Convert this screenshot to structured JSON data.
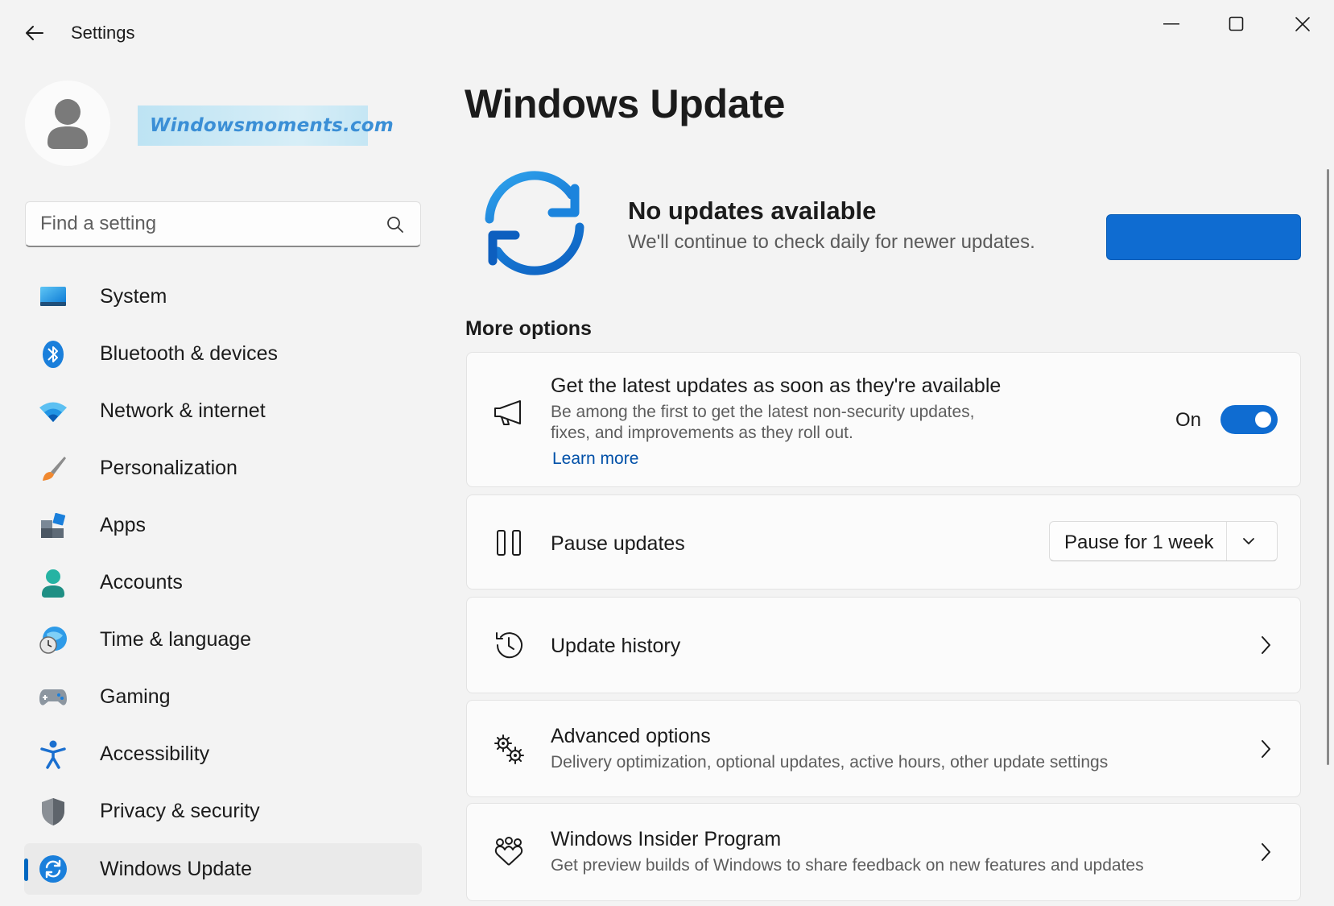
{
  "window": {
    "title": "Settings",
    "controls": [
      "minimize",
      "maximize",
      "close"
    ]
  },
  "profile": {
    "banner_text": "Windowsmoments.com"
  },
  "search": {
    "placeholder": "Find a setting"
  },
  "sidebar": {
    "items": [
      {
        "label": "System",
        "icon": "monitor-icon"
      },
      {
        "label": "Bluetooth & devices",
        "icon": "bluetooth-icon"
      },
      {
        "label": "Network & internet",
        "icon": "wifi-icon"
      },
      {
        "label": "Personalization",
        "icon": "paintbrush-icon"
      },
      {
        "label": "Apps",
        "icon": "apps-icon"
      },
      {
        "label": "Accounts",
        "icon": "person-icon"
      },
      {
        "label": "Time & language",
        "icon": "globe-clock-icon"
      },
      {
        "label": "Gaming",
        "icon": "gamepad-icon"
      },
      {
        "label": "Accessibility",
        "icon": "accessibility-icon"
      },
      {
        "label": "Privacy & security",
        "icon": "shield-icon"
      },
      {
        "label": "Windows Update",
        "icon": "sync-icon",
        "selected": true
      }
    ]
  },
  "main": {
    "title": "Windows Update",
    "status": {
      "title": "No updates available",
      "subtitle": "We'll continue to check daily for newer updates.",
      "button_label": ""
    },
    "more_options_label": "More options",
    "cards": {
      "latest": {
        "title": "Get the latest updates as soon as they're available",
        "desc_line1": "Be among the first to get the latest non-security updates,",
        "desc_line2": "fixes, and improvements as they roll out.",
        "link": "Learn more",
        "toggle_label": "On",
        "toggle_on": true
      },
      "pause": {
        "title": "Pause updates",
        "dropdown_value": "Pause for 1 week"
      },
      "history": {
        "title": "Update history"
      },
      "advanced": {
        "title": "Advanced options",
        "desc": "Delivery optimization, optional updates, active hours, other update settings"
      },
      "insider": {
        "title": "Windows Insider Program",
        "desc": "Get preview builds of Windows to share feedback on new features and updates"
      }
    }
  },
  "colors": {
    "accent": "#0f6cd1",
    "background": "#f3f3f3",
    "card": "#fbfbfb"
  }
}
